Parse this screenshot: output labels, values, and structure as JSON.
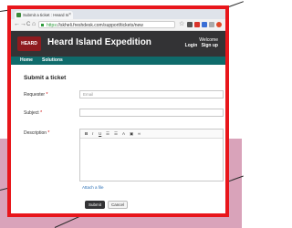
{
  "browser": {
    "tab_title": "Submit a ticket : Heard Is",
    "url_scheme": "https",
    "url_rest": "://skheli.freshdesk.com/support/tickets/new",
    "back_glyph": "←",
    "forward_glyph": "→",
    "reload_glyph": "C",
    "home_glyph": "⌂",
    "star_glyph": "☆",
    "close_tab_glyph": "×"
  },
  "header": {
    "logo_text": "HEARD",
    "title": "Heard Island Expedition",
    "welcome": "Welcome",
    "login": "Login",
    "signup": "Sign up"
  },
  "nav": {
    "home": "Home",
    "solutions": "Solutions"
  },
  "form": {
    "title": "Submit a ticket",
    "requester_label": "Requester",
    "requester_placeholder": "Email",
    "subject_label": "Subject",
    "description_label": "Description",
    "required_mark": "*",
    "toolbar": {
      "bold": "B",
      "italic": "I",
      "underline": "U",
      "list": "☰",
      "font": "A",
      "image": "▣",
      "link": "∞"
    },
    "attach": "Attach a file",
    "submit": "Submit",
    "cancel": "Cancel"
  },
  "colors": {
    "frame": "#e8161b",
    "header_bg": "#333335",
    "nav_bg": "#0f6b6b",
    "logo_bg": "#8e1b1f",
    "background_pink": "#d9a3ba"
  }
}
